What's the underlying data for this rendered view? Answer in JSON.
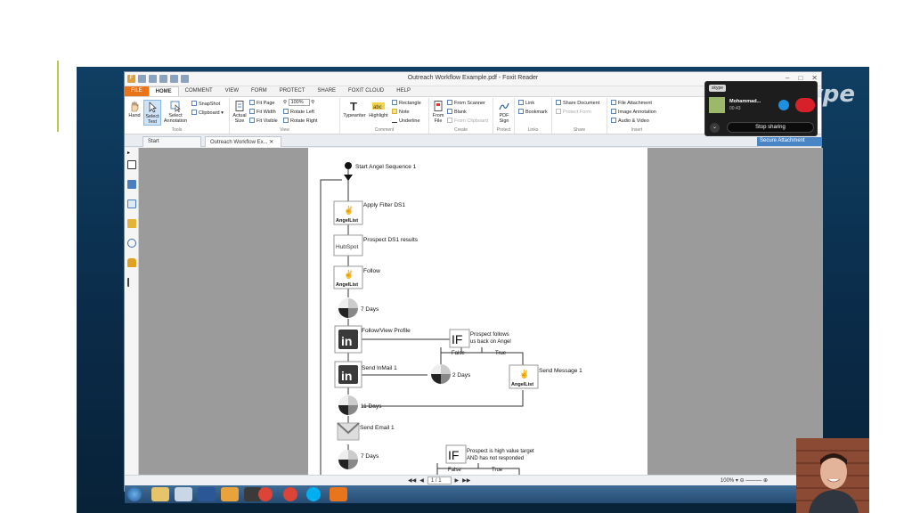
{
  "window": {
    "title": "Outreach Workflow Example.pdf - Foxit Reader"
  },
  "menu": [
    "FILE",
    "HOME",
    "COMMENT",
    "VIEW",
    "FORM",
    "PROTECT",
    "SHARE",
    "FOXIT CLOUD",
    "HELP"
  ],
  "ribbon": {
    "hand": "Hand",
    "select_text": "Select Text",
    "select_annotation": "Select Annotation",
    "snapshot": "SnapShot",
    "clipboard": "Clipboard",
    "tools_label": "Tools",
    "actual_size": "Actual Size",
    "fit_page": "Fit Page",
    "fit_width": "Fit Width",
    "fit_visible": "Fit Visible",
    "zoom_value": "100%",
    "rotate_left": "Rotate Left",
    "rotate_right": "Rotate Right",
    "view_label": "View",
    "typewriter": "Typewriter",
    "highlight": "Highlight",
    "rectangle": "Rectangle",
    "note": "Note",
    "underline": "Underline",
    "comment_label": "Comment",
    "from_file": "From File",
    "from_scanner": "From Scanner",
    "blank": "Blank",
    "from_clipboard": "From Clipboard",
    "create_label": "Create",
    "pdf_sign": "PDF Sign",
    "protect_label": "Protect",
    "link": "Link",
    "bookmark": "Bookmark",
    "links_label": "Links",
    "share_document": "Share Document",
    "protect_form": "Protect Form",
    "share_label": "Share",
    "file_attachment": "File Attachment",
    "image_annotation": "Image Annotation",
    "audio_video": "Audio & Video",
    "insert_label": "Insert"
  },
  "tabs": [
    "Start",
    "Outreach Workflow Ex..."
  ],
  "workflow": {
    "start": "Start Angel Sequence 1",
    "apply_filter": "Apply Filter DS1",
    "angellist": "AngelList",
    "hubspot": "HubSpot",
    "prospect_results": "Prospect DS1 results",
    "follow": "Follow",
    "days7": "7 Days",
    "follow_view": "Follow/View Profile",
    "if": "IF",
    "prospect_follows_1": "Prospect follows",
    "prospect_follows_2": "us back on Angel",
    "false": "False",
    "true": "True",
    "send_inmail": "Send InMail 1",
    "days2": "2 Days",
    "send_message": "Send Message 1",
    "days11": "11 Days",
    "send_email": "Send Email 1",
    "days7b": "7 Days",
    "high_value_1": "Prospect is high value target",
    "high_value_2": "AND has not responded",
    "linkedin": "in"
  },
  "status": {
    "page": "1 / 1",
    "zoom": "100%"
  },
  "skype": {
    "brand": "skype",
    "header": "skype",
    "contact": "Mohammad...",
    "time": "00:43",
    "stop_sharing": "Stop sharing",
    "secure": "Secure Attachment"
  },
  "colors": {
    "accent": "#e8741c",
    "skype_blue": "#1e90e0",
    "hangup_red": "#d8202a"
  }
}
